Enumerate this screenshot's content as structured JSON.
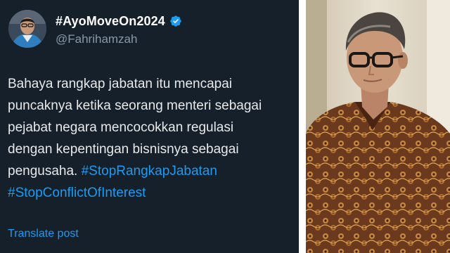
{
  "tweet": {
    "display_name": "#AyoMoveOn2024",
    "handle": "@Fahrihamzah",
    "verified": true,
    "text_lines": [
      "Bahaya rangkap jabatan itu mencapai",
      "puncaknya ketika seorang menteri sebagai",
      "pejabat negara mencocokkan regulasi",
      "dengan kepentingan bisnisnya sebagai",
      "pengusaha."
    ],
    "hashtags": [
      "#StopRangkapJabatan",
      "#StopConflictOfInterest"
    ],
    "translate_label": "Translate post"
  },
  "icons": {
    "verified": "verified-badge-icon"
  },
  "colors": {
    "background": "#15202b",
    "text": "#e7e9ea",
    "handle": "#8b98a5",
    "link": "#1d9bf0"
  }
}
